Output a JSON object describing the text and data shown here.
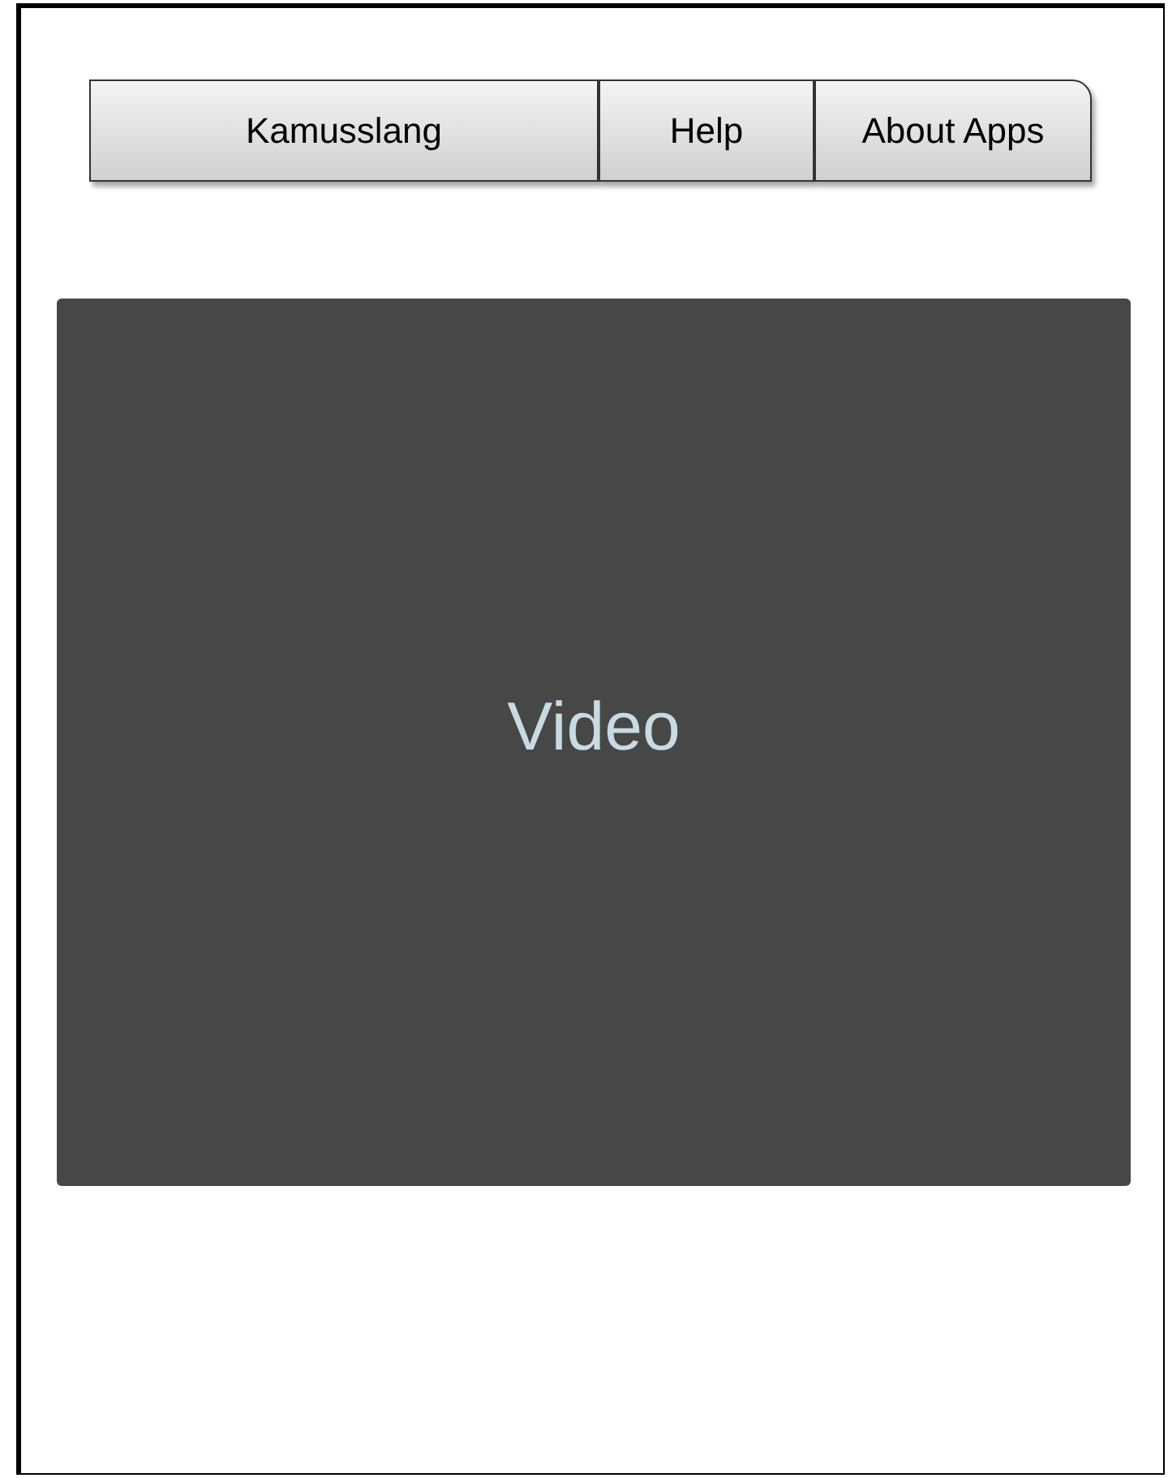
{
  "tabs": [
    {
      "label": "Kamusslang",
      "selected": false
    },
    {
      "label": "Help",
      "selected": false
    },
    {
      "label": "About Apps",
      "selected": false
    }
  ],
  "video": {
    "label": "Video"
  }
}
